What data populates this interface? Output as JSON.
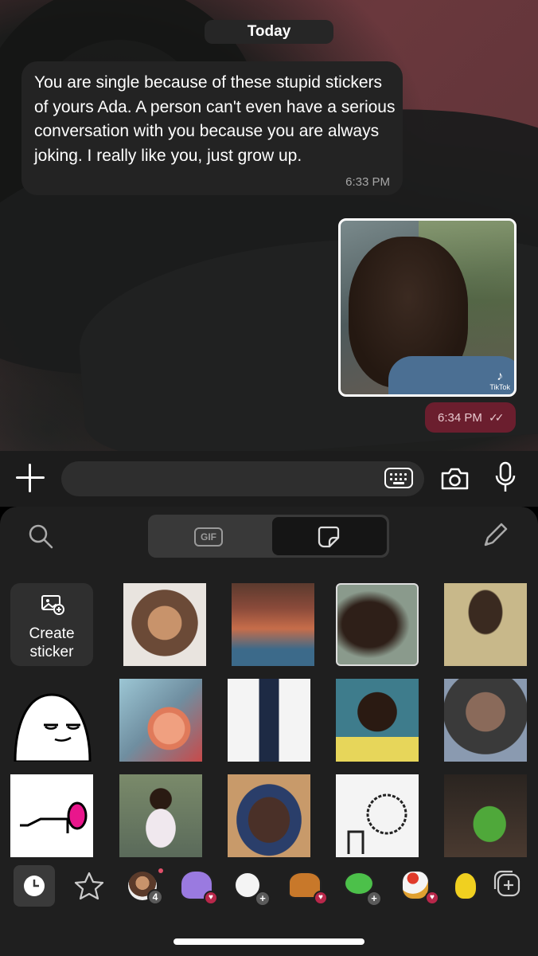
{
  "chat": {
    "date_label": "Today",
    "incoming_message": {
      "text": "You are single because of these stupid stickers of yours Ada. A person can't even have a serious conversation with you because you are always joking. I really like you, just grow up.",
      "time": "6:33 PM"
    },
    "outgoing_media": {
      "watermark": "TikTok",
      "time": "6:34 PM",
      "status": "read"
    }
  },
  "composer": {
    "placeholder": ""
  },
  "sticker_panel": {
    "tabs": [
      {
        "label": "GIF",
        "selected": false
      },
      {
        "label": "stickers",
        "selected": true
      }
    ],
    "create_sticker_label": "Create sticker",
    "stickers": [
      {
        "name": "laughing-girl-sticker",
        "colors": [
          "#e9e4df",
          "#6b4a37"
        ]
      },
      {
        "name": "wrapped-chihuahua-sticker",
        "colors": [
          "#5b3a2e",
          "#c76d4a"
        ]
      },
      {
        "name": "crying-man-sticker",
        "colors": [
          "#8a9a8c",
          "#2e1f18"
        ]
      },
      {
        "name": "boy-overalls-sticker",
        "colors": [
          "#c8b88a",
          "#5a6a8c"
        ]
      },
      {
        "name": "smirking-blob-sticker",
        "colors": [
          "#ffffff",
          "#000000"
        ]
      },
      {
        "name": "cartoon-baby-sticker",
        "colors": [
          "#9cc6d4",
          "#e07a5a"
        ]
      },
      {
        "name": "man-in-suit-sticker",
        "colors": [
          "#f4f4f4",
          "#1d2a44"
        ]
      },
      {
        "name": "thinking-boy-sticker",
        "colors": [
          "#3e7c8c",
          "#e7d65a"
        ]
      },
      {
        "name": "old-face-boy-sticker",
        "colors": [
          "#3a3a3a",
          "#8a6a5a"
        ]
      },
      {
        "name": "pushup-doodle-sticker",
        "colors": [
          "#ffffff",
          "#e9168c"
        ]
      },
      {
        "name": "crying-girl-sticker",
        "colors": [
          "#7a8a6a",
          "#f0e8ee"
        ]
      },
      {
        "name": "unimpressed-woman-sticker",
        "colors": [
          "#2a3e6a",
          "#4a3028"
        ]
      },
      {
        "name": "hand-drawn-doodle-sticker",
        "colors": [
          "#f4f4f4",
          "#222222"
        ]
      },
      {
        "name": "dancing-woman-sticker",
        "colors": [
          "#2a2420",
          "#4fa83a"
        ]
      }
    ],
    "bottom_bar": {
      "pack_badge_count": "4",
      "packs": [
        {
          "name": "recent-icon",
          "selected": true
        },
        {
          "name": "favorites-star-icon",
          "selected": false
        },
        {
          "name": "woman-pack-icon",
          "badge": "4"
        },
        {
          "name": "purple-creature-pack-icon",
          "badge": "heart"
        },
        {
          "name": "white-bird-pack-icon",
          "badge": "plus"
        },
        {
          "name": "beaver-pack-icon",
          "badge": "heart"
        },
        {
          "name": "green-frog-pack-icon",
          "badge": "plus"
        },
        {
          "name": "rooster-pack-icon",
          "badge": "heart"
        },
        {
          "name": "yellow-bird-pack-icon",
          "badge": ""
        },
        {
          "name": "add-pack-icon",
          "selected": false
        }
      ]
    }
  },
  "colors": {
    "accent": "#6b1e2e",
    "bubble_incoming": "#232323",
    "panel_bg": "#1f1f1f"
  }
}
